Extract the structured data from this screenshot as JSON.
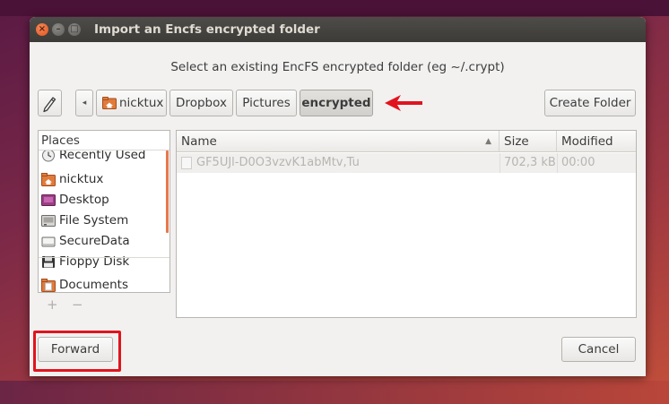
{
  "window": {
    "title": "Import an Encfs encrypted folder"
  },
  "titlebar_buttons": {
    "close": "×",
    "minimize": "–",
    "maximize": "□"
  },
  "prompt": "Select an existing EncFS encrypted folder (eg ~/.crypt)",
  "toolbar": {
    "back_glyph": "◂",
    "breadcrumbs": [
      "nicktux",
      "Dropbox",
      "Pictures",
      "encrypted"
    ],
    "create_folder": "Create Folder"
  },
  "places": {
    "header": "Places",
    "items": [
      {
        "label": "Recently Used",
        "icon": "clock-icon"
      },
      {
        "label": "nicktux",
        "icon": "home-folder-icon"
      },
      {
        "label": "Desktop",
        "icon": "desktop-icon"
      },
      {
        "label": "File System",
        "icon": "harddisk-icon"
      },
      {
        "label": "SecureData",
        "icon": "drive-icon"
      },
      {
        "label": "Floppy Disk",
        "icon": "floppy-icon"
      },
      {
        "label": "Documents",
        "icon": "documents-folder-icon"
      }
    ],
    "add": "+",
    "remove": "−"
  },
  "files": {
    "columns": {
      "name": "Name",
      "size": "Size",
      "modified": "Modified"
    },
    "rows": [
      {
        "name": "GF5UJl-D0O3vzvK1abMtv,Tu",
        "size": "702,3 kB",
        "modified": "00:00"
      }
    ]
  },
  "buttons": {
    "forward": "Forward",
    "cancel": "Cancel"
  },
  "colors": {
    "accent": "#e8764a",
    "annotation": "#e1141e",
    "titlebar": "#3c3b37"
  }
}
